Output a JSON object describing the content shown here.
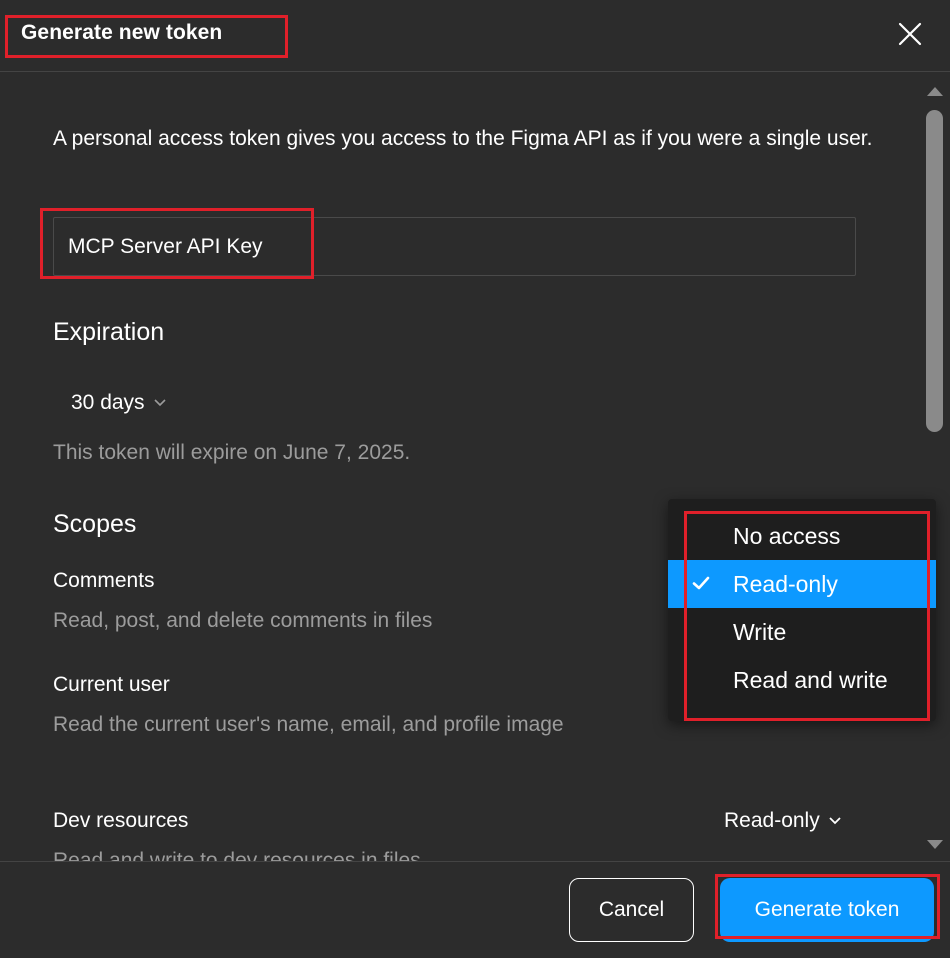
{
  "dialog": {
    "title": "Generate new token",
    "description": "A personal access token gives you access to the Figma API as if you were a single user.",
    "token_name_value": "MCP Server API Key",
    "expiration": {
      "heading": "Expiration",
      "selected": "30 days",
      "note": "This token will expire on June 7, 2025."
    },
    "scopes": {
      "heading": "Scopes",
      "items": [
        {
          "name": "Comments",
          "description": "Read, post, and delete comments in files"
        },
        {
          "name": "Current user",
          "description": "Read the current user's name, email, and profile image"
        },
        {
          "name": "Dev resources",
          "description": "Read and write to dev resources in files",
          "access": "Read-only"
        }
      ]
    },
    "access_menu": {
      "options": [
        "No access",
        "Read-only",
        "Write",
        "Read and write"
      ],
      "selected": "Read-only"
    },
    "footer": {
      "cancel_label": "Cancel",
      "generate_label": "Generate token"
    }
  },
  "colors": {
    "background": "#2c2c2c",
    "accent": "#0d99ff",
    "menu_background": "#1e1e1e",
    "muted_text": "#9c9c9c",
    "annotation": "#e0202a"
  },
  "icons": [
    "close-icon",
    "chevron-down-icon",
    "check-icon",
    "scroll-up-arrow-icon",
    "scroll-down-arrow-icon"
  ]
}
